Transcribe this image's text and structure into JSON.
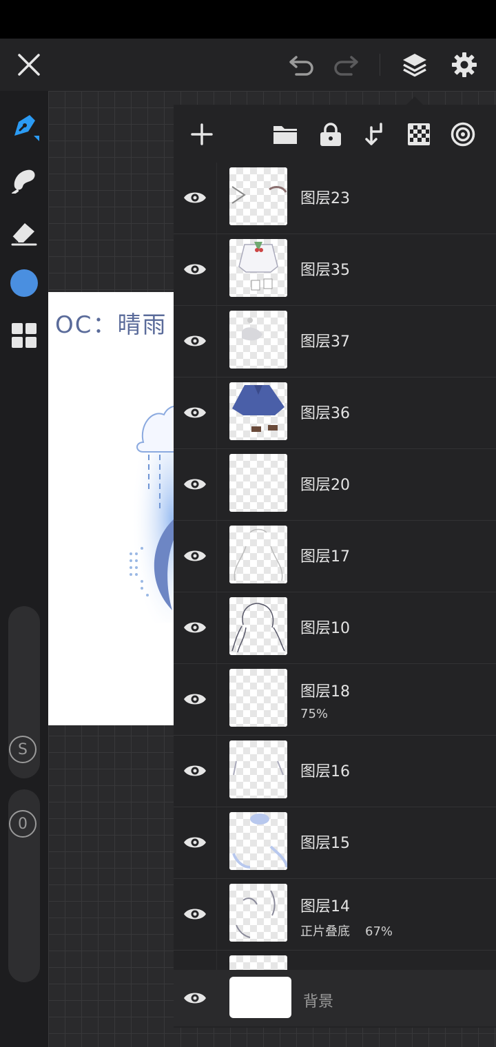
{
  "toolbar_top": {
    "close": "close",
    "undo": "undo",
    "redo": "redo",
    "layers": "layers",
    "settings": "settings"
  },
  "artwork": {
    "title": "OC：晴雨"
  },
  "side_tools": {
    "brush_color": "#4a8fe0",
    "slider_size_label": "S",
    "slider_opacity_label": "0"
  },
  "layers": [
    {
      "name": "图层23",
      "blend": "",
      "opacity": ""
    },
    {
      "name": "图层35",
      "blend": "",
      "opacity": ""
    },
    {
      "name": "图层37",
      "blend": "",
      "opacity": ""
    },
    {
      "name": "图层36",
      "blend": "",
      "opacity": ""
    },
    {
      "name": "图层20",
      "blend": "",
      "opacity": ""
    },
    {
      "name": "图层17",
      "blend": "",
      "opacity": ""
    },
    {
      "name": "图层10",
      "blend": "",
      "opacity": ""
    },
    {
      "name": "图层18",
      "blend": "",
      "opacity": "75%"
    },
    {
      "name": "图层16",
      "blend": "",
      "opacity": ""
    },
    {
      "name": "图层15",
      "blend": "",
      "opacity": ""
    },
    {
      "name": "图层14",
      "blend": "正片叠底",
      "opacity": "67%"
    }
  ],
  "background_layer": {
    "name": "背景"
  },
  "colors": {
    "accent": "#2b9bf4",
    "panel": "#232325"
  }
}
